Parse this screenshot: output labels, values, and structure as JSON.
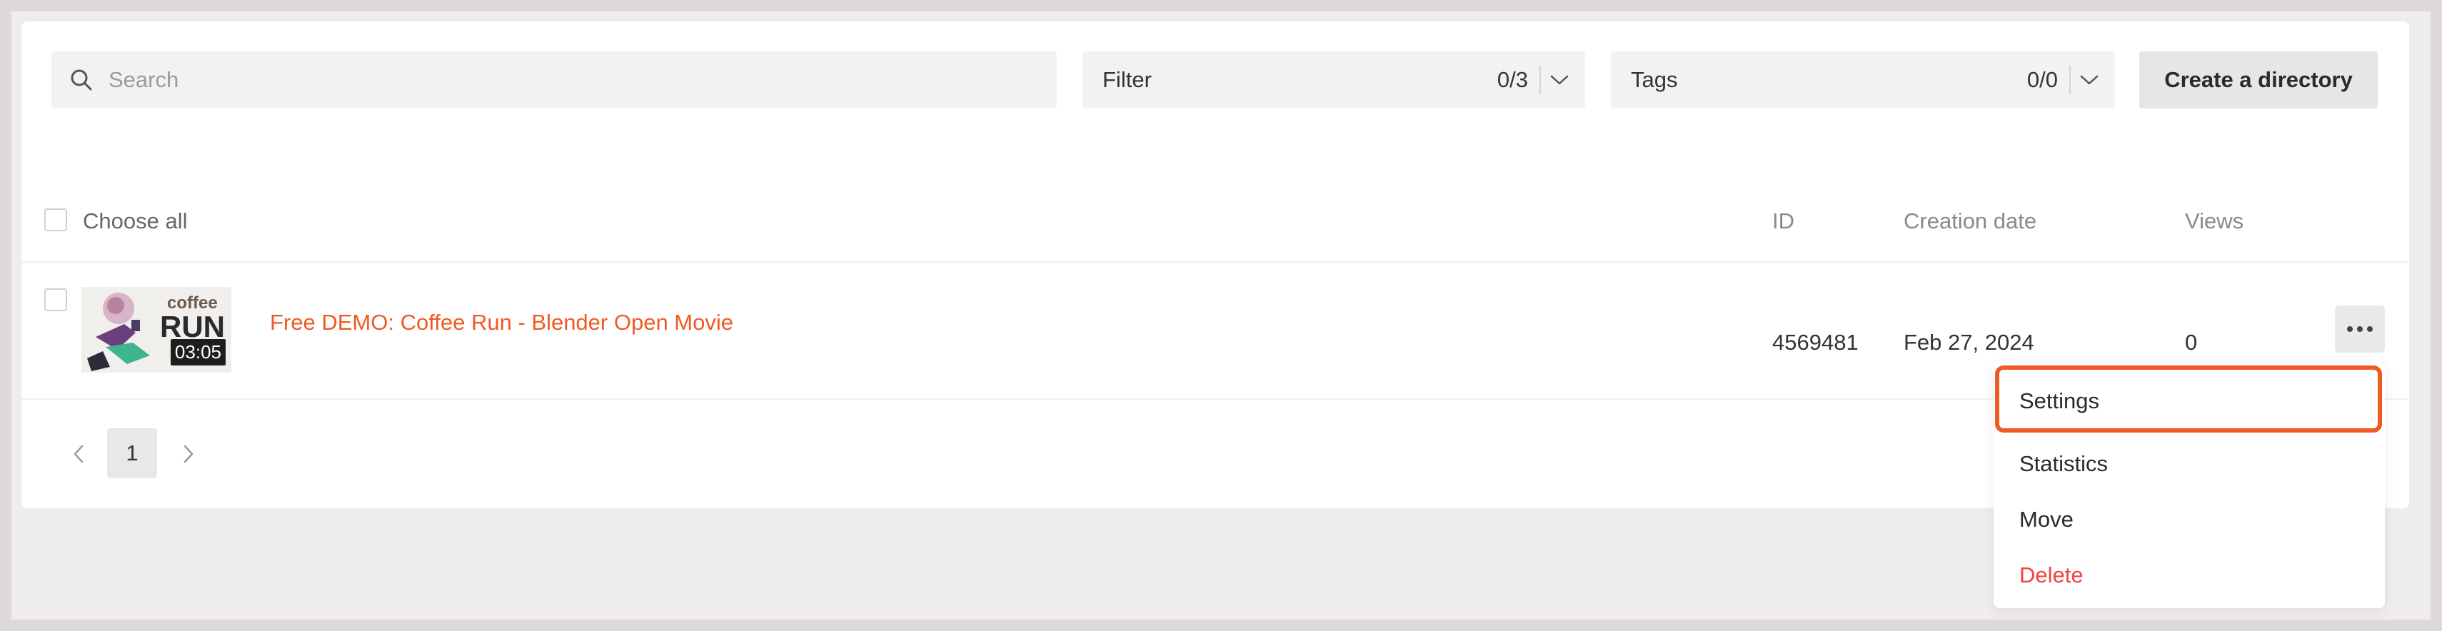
{
  "toolbar": {
    "search_placeholder": "Search",
    "filter": {
      "label": "Filter",
      "count": "0/3"
    },
    "tags": {
      "label": "Tags",
      "count": "0/0"
    },
    "create_label": "Create a directory"
  },
  "table": {
    "choose_all": "Choose all",
    "columns": {
      "id": "ID",
      "creation_date": "Creation date",
      "views": "Views"
    },
    "rows": [
      {
        "title": "Free DEMO: Coffee Run - Blender Open Movie",
        "thumb_text_top": "coffee",
        "thumb_text_bottom": "RUN",
        "duration": "03:05",
        "id": "4569481",
        "creation_date": "Feb 27, 2024",
        "views": "0"
      }
    ]
  },
  "pagination": {
    "current": "1"
  },
  "menu": {
    "items": [
      "Settings",
      "Statistics",
      "Move",
      "Delete"
    ],
    "highlighted": "Settings"
  },
  "colors": {
    "accent": "#f05a22",
    "danger": "#f0453a"
  }
}
